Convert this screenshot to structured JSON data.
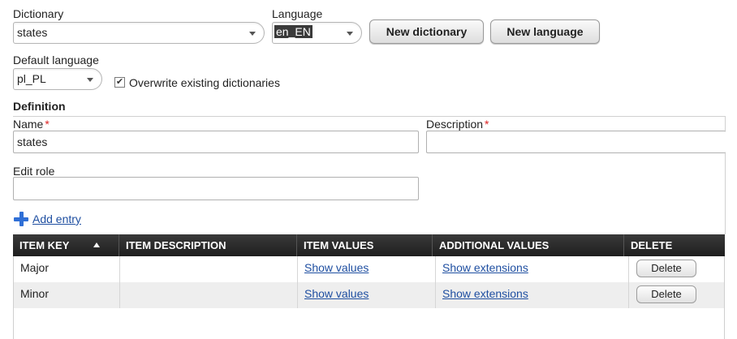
{
  "dictionary": {
    "label": "Dictionary",
    "value": "states"
  },
  "language": {
    "label": "Language",
    "value": "en_EN"
  },
  "buttons": {
    "new_dictionary": "New dictionary",
    "new_language": "New language"
  },
  "default_language": {
    "label": "Default language",
    "value": "pl_PL"
  },
  "overwrite": {
    "label": "Overwrite existing dictionaries",
    "checked": true
  },
  "definition": {
    "title": "Definition",
    "name_label": "Name",
    "name_value": "states",
    "description_label": "Description",
    "description_value": "",
    "required_mark": "*",
    "edit_role_label": "Edit role",
    "edit_role_value": ""
  },
  "add_entry": {
    "label": "Add entry",
    "icon": "plus-icon"
  },
  "grid": {
    "columns": [
      "ITEM KEY",
      "ITEM DESCRIPTION",
      "ITEM VALUES",
      "ADDITIONAL VALUES",
      "DELETE"
    ],
    "rows": [
      {
        "key": "Major",
        "description": "",
        "values_link": "Show values",
        "extensions_link": "Show extensions",
        "delete": "Delete"
      },
      {
        "key": "Minor",
        "description": "",
        "values_link": "Show values",
        "extensions_link": "Show extensions",
        "delete": "Delete"
      }
    ]
  },
  "colors": {
    "link": "#1f4fa1",
    "header_bg": "#2a2a2a",
    "required": "#dd2222",
    "accent_icon": "#2f6fd6"
  }
}
